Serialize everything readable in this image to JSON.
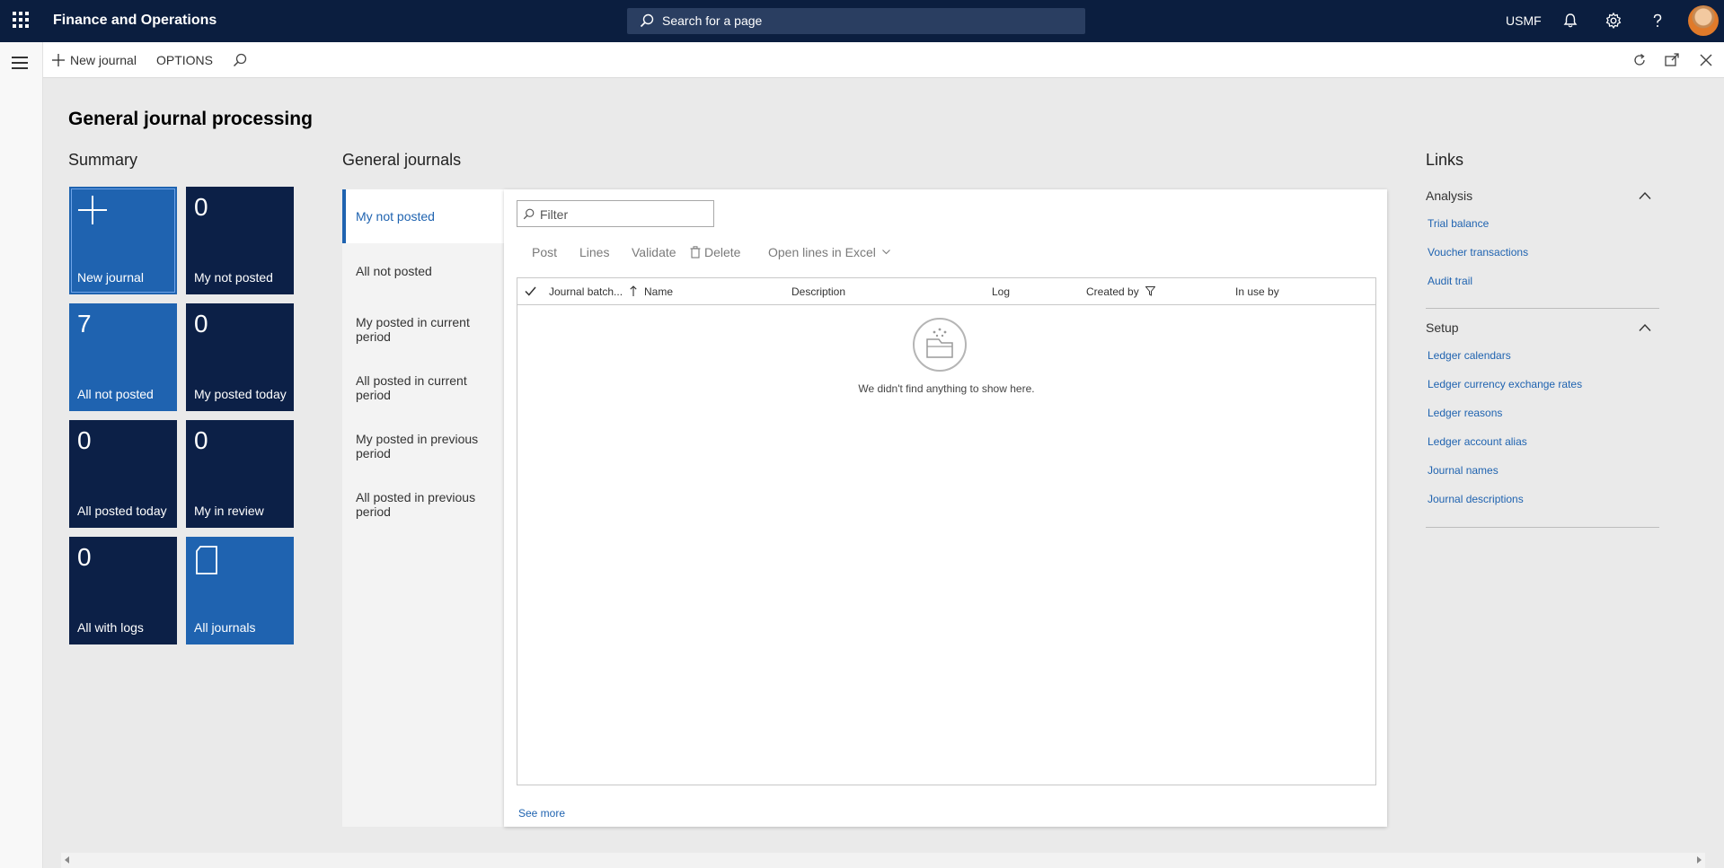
{
  "topbar": {
    "app_title": "Finance and Operations",
    "search_placeholder": "Search for a page",
    "company": "USMF",
    "icons": [
      "waffle-icon",
      "bell-icon",
      "gear-icon",
      "help-icon",
      "avatar"
    ]
  },
  "actionpane": {
    "new_journal": "New journal",
    "options": "OPTIONS"
  },
  "page": {
    "title": "General journal processing"
  },
  "summary": {
    "title": "Summary",
    "tiles": [
      {
        "count": "",
        "label": "New journal",
        "style": "light",
        "icon": "plus-icon"
      },
      {
        "count": "0",
        "label": "My not posted",
        "style": "dark"
      },
      {
        "count": "7",
        "label": "All not posted",
        "style": "light"
      },
      {
        "count": "0",
        "label": "My posted today",
        "style": "dark"
      },
      {
        "count": "0",
        "label": "All posted today",
        "style": "dark"
      },
      {
        "count": "0",
        "label": "My in review",
        "style": "dark"
      },
      {
        "count": "0",
        "label": "All with logs",
        "style": "dark"
      },
      {
        "count": "",
        "label": "All journals",
        "style": "light",
        "icon": "document-icon"
      }
    ]
  },
  "journals": {
    "title": "General journals",
    "tabs": [
      {
        "label": "My not posted"
      },
      {
        "label": "All not posted"
      },
      {
        "label": "My posted in current period"
      },
      {
        "label": "All posted in current period"
      },
      {
        "label": "My posted in previous period"
      },
      {
        "label": "All posted in previous period"
      }
    ],
    "filter_placeholder": "Filter",
    "actions": {
      "post": "Post",
      "lines": "Lines",
      "validate": "Validate",
      "delete": "Delete",
      "open_excel": "Open lines in Excel"
    },
    "columns": {
      "journal_batch": "Journal batch...",
      "name": "Name",
      "description": "Description",
      "log": "Log",
      "created_by": "Created by",
      "in_use_by": "In use by"
    },
    "empty_message": "We didn't find anything to show here.",
    "see_more": "See more"
  },
  "links": {
    "title": "Links",
    "groups": [
      {
        "title": "Analysis",
        "items": [
          "Trial balance",
          "Voucher transactions",
          "Audit trail"
        ]
      },
      {
        "title": "Setup",
        "items": [
          "Ledger calendars",
          "Ledger currency exchange rates",
          "Ledger reasons",
          "Ledger account alias",
          "Journal names",
          "Journal descriptions"
        ]
      }
    ]
  },
  "colors": {
    "topbar": "#0b1e3f",
    "tile_light": "#1f63b0",
    "tile_dark": "#0c2047",
    "link": "#1f63b0"
  }
}
